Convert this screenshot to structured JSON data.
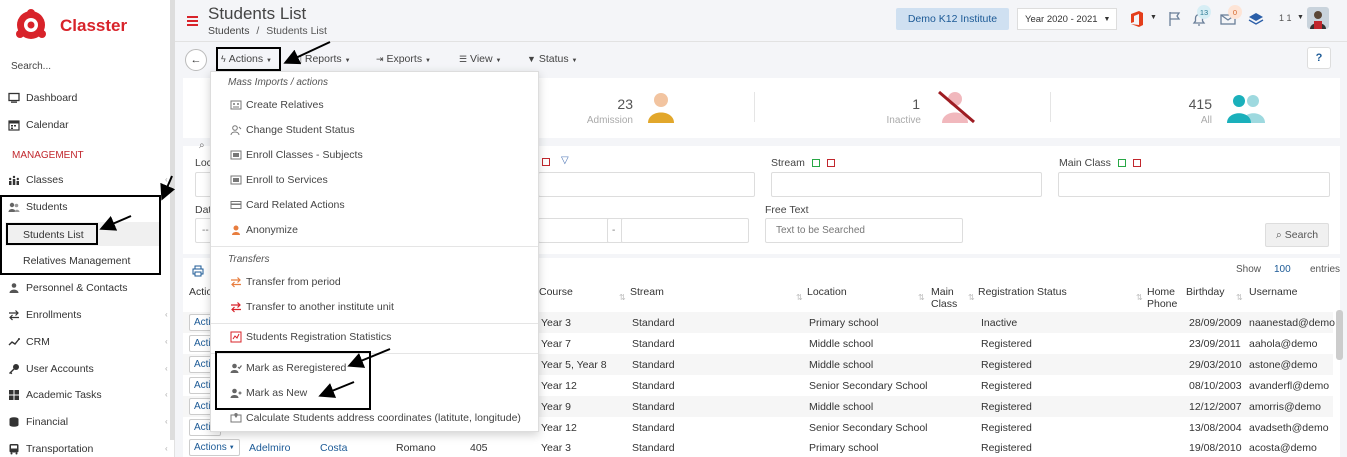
{
  "app": {
    "name": "Classter",
    "search_placeholder": "Search..."
  },
  "sidebar": {
    "items": [
      {
        "label": "Dashboard",
        "icon": "monitor-icon"
      },
      {
        "label": "Calendar",
        "icon": "calendar-icon"
      },
      {
        "label": "Classes",
        "icon": "classes-icon"
      },
      {
        "label": "Students",
        "icon": "students-icon"
      },
      {
        "label": "Personnel & Contacts",
        "icon": "personnel-icon"
      },
      {
        "label": "Enrollments",
        "icon": "enrollments-icon"
      },
      {
        "label": "CRM",
        "icon": "crm-icon"
      },
      {
        "label": "User Accounts",
        "icon": "key-icon"
      },
      {
        "label": "Academic Tasks",
        "icon": "tasks-icon"
      },
      {
        "label": "Financial",
        "icon": "financial-icon"
      },
      {
        "label": "Transportation",
        "icon": "bus-icon"
      }
    ],
    "section": "MANAGEMENT",
    "students_sub": [
      "Students List",
      "Relatives Management"
    ]
  },
  "header": {
    "title": "Students List",
    "breadcrumb": [
      "Students",
      "Students List"
    ],
    "breadcrumb_sep": "/",
    "institute": "Demo K12 Institute",
    "year": "Year 2020 - 2021",
    "notif_count": "13",
    "mail_count": "0",
    "user_label": "1 1"
  },
  "toolbar": {
    "actions": "Actions",
    "reports": "Reports",
    "exports": "Exports",
    "view": "View",
    "status": "Status",
    "help": "?"
  },
  "stats": [
    {
      "value": "23",
      "label": "Admission"
    },
    {
      "value": "1",
      "label": "Inactive"
    },
    {
      "value": "415",
      "label": "All"
    }
  ],
  "filters": {
    "location_label": "Loc",
    "date_label": "Dat",
    "date_value": "--",
    "stream_label": "Stream",
    "main_class_label": "Main Class",
    "free_text_label": "Free Text",
    "free_text_placeholder": "Text to be Searched",
    "range_sep": "-",
    "search_btn": "Search"
  },
  "table": {
    "show_label": "Show",
    "show_value": "100",
    "entries_label": "entries",
    "headers": [
      "Actio",
      "Course",
      "Stream",
      "Location",
      "Main Class",
      "Registration Status",
      "Home Phone",
      "Birthday",
      "Username"
    ],
    "rows": [
      {
        "action": "Actio",
        "course": "Year 3",
        "stream": "Standard",
        "location": "Primary school",
        "status": "Inactive",
        "birthday": "28/09/2009",
        "username": "naanestad@demo"
      },
      {
        "action": "Actio",
        "course": "Year 7",
        "stream": "Standard",
        "location": "Middle school",
        "status": "Registered",
        "birthday": "23/09/2011",
        "username": "aahola@demo"
      },
      {
        "action": "Actio",
        "course": "Year 5, Year 8",
        "stream": "Standard",
        "location": "Middle school",
        "status": "Registered",
        "birthday": "29/03/2010",
        "username": "astone@demo"
      },
      {
        "action": "Actio",
        "course": "Year 12",
        "stream": "Standard",
        "location": "Senior Secondary School",
        "status": "Registered",
        "birthday": "08/10/2003",
        "username": "avanderfl@demo"
      },
      {
        "action": "Actio",
        "course": "Year 9",
        "stream": "Standard",
        "location": "Middle school",
        "status": "Registered",
        "birthday": "12/12/2007",
        "username": "amorris@demo"
      },
      {
        "action": "Actio",
        "course": "Year 12",
        "stream": "Standard",
        "location": "Senior Secondary School",
        "status": "Registered",
        "birthday": "13/08/2004",
        "username": "avadseth@demo"
      }
    ],
    "last_row": {
      "action": "Actions",
      "first_name": "Adelmiro",
      "last_name": "Costa",
      "origin": "Romano",
      "code": "405",
      "course": "Year 3",
      "stream": "Standard",
      "location": "Primary school",
      "status": "Registered",
      "birthday": "19/08/2010",
      "username": "acosta@demo"
    }
  },
  "dropdown": {
    "section1": "Mass Imports / actions",
    "items1": [
      "Create Relatives",
      "Change Student Status",
      "Enroll Classes - Subjects",
      "Enroll to Services",
      "Card Related Actions",
      "Anonymize"
    ],
    "section2": "Transfers",
    "items2": [
      "Transfer from period",
      "Transfer to another institute unit"
    ],
    "items3": [
      "Students Registration Statistics"
    ],
    "items4": [
      "Mark as Reregistered",
      "Mark as New",
      "Calculate Students address coordinates (latitute, longitude)"
    ]
  },
  "colors": {
    "brand": "#d8232a",
    "link": "#1c5a96",
    "accent_bg": "#cfe0f1"
  }
}
